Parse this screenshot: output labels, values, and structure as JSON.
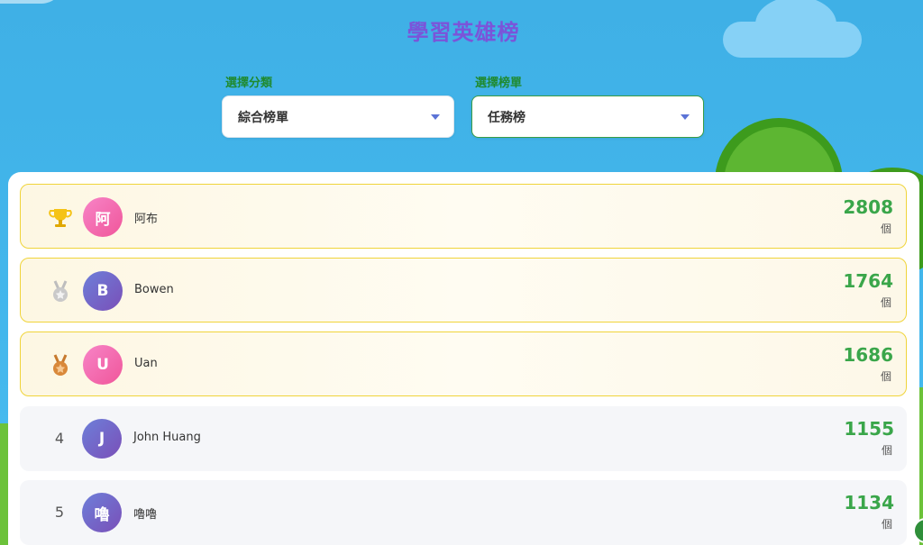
{
  "header": {
    "title": "學習英雄榜"
  },
  "filters": {
    "category": {
      "label": "選擇分類",
      "value": "綜合榜單"
    },
    "board": {
      "label": "選擇榜單",
      "value": "任務榜"
    }
  },
  "leaderboard": {
    "entries": [
      {
        "rank": "1",
        "icon": "trophy-icon",
        "initial": "阿",
        "name": "阿布",
        "score": "2808",
        "unit": "個"
      },
      {
        "rank": "2",
        "icon": "silver-medal-icon",
        "initial": "B",
        "name": "Bowen",
        "score": "1764",
        "unit": "個"
      },
      {
        "rank": "3",
        "icon": "bronze-medal-icon",
        "initial": "U",
        "name": "Uan",
        "score": "1686",
        "unit": "個"
      },
      {
        "rank": "4",
        "icon": "",
        "initial": "J",
        "name": "John Huang",
        "score": "1155",
        "unit": "個"
      },
      {
        "rank": "5",
        "icon": "",
        "initial": "嚕",
        "name": "嚕嚕",
        "score": "1134",
        "unit": "個"
      }
    ]
  },
  "colors": {
    "title": "#7b54d9",
    "score": "#3aa64a",
    "label": "#1f8a2f",
    "top_border": "#f0d43a"
  }
}
